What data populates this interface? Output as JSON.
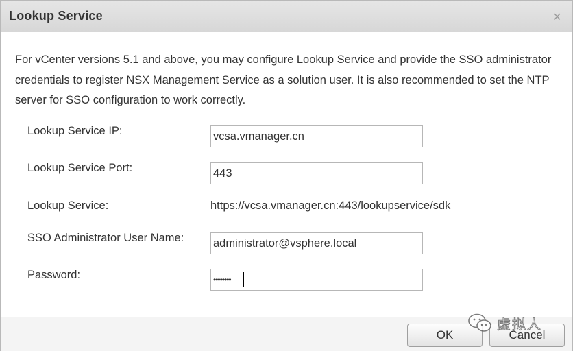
{
  "dialog": {
    "title": "Lookup Service",
    "close_icon": "close-icon",
    "description": "For vCenter versions 5.1 and above, you may configure Lookup Service and provide the SSO administrator credentials to register NSX Management Service as a solution user. It is also recommended to set the NTP server for SSO configuration to work correctly."
  },
  "form": {
    "lookup_ip": {
      "label": "Lookup Service IP:",
      "value": "vcsa.vmanager.cn"
    },
    "lookup_port": {
      "label": "Lookup Service Port:",
      "value": "443"
    },
    "lookup_service": {
      "label": "Lookup Service:",
      "value": "https://vcsa.vmanager.cn:443/lookupservice/sdk"
    },
    "sso_user": {
      "label": "SSO Administrator User Name:",
      "value": "administrator@vsphere.local"
    },
    "password": {
      "label": "Password:",
      "value": "••••••••"
    }
  },
  "footer": {
    "ok_label": "OK",
    "cancel_label": "Cancel"
  },
  "watermark": {
    "icon": "wechat-icon",
    "text": "虚拟人"
  },
  "colors": {
    "titlebar": "#dcdcdc",
    "text": "#333333",
    "border": "#b7b7b7",
    "footer": "#f4f4f4"
  }
}
